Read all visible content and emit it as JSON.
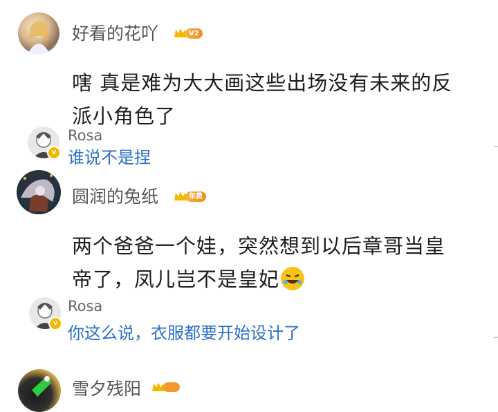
{
  "comments": [
    {
      "username": "好看的花吖",
      "level_badge": "V2",
      "text_line1": "嗐 真是难为大大画这些出场没有未来的反",
      "text_line2": "派小角色了",
      "reply": {
        "username": "Rosa",
        "text": "谁说不是捏"
      }
    },
    {
      "username": "圆润的兔纸",
      "level_badge": "年费",
      "text_line1": "两个爸爸一个娃，突然想到以后章哥当皇",
      "text_line2": "帝了，凤儿岂不是皇妃",
      "reply": {
        "username": "Rosa",
        "text": "你这么说，衣服都要开始设计了"
      }
    },
    {
      "username": "雪夕残阳"
    }
  ],
  "colors": {
    "link_blue": "#2a6fc9",
    "crown_gold": "#f5b800",
    "text_dark": "#1d1d1d",
    "username_gray": "#555555"
  }
}
